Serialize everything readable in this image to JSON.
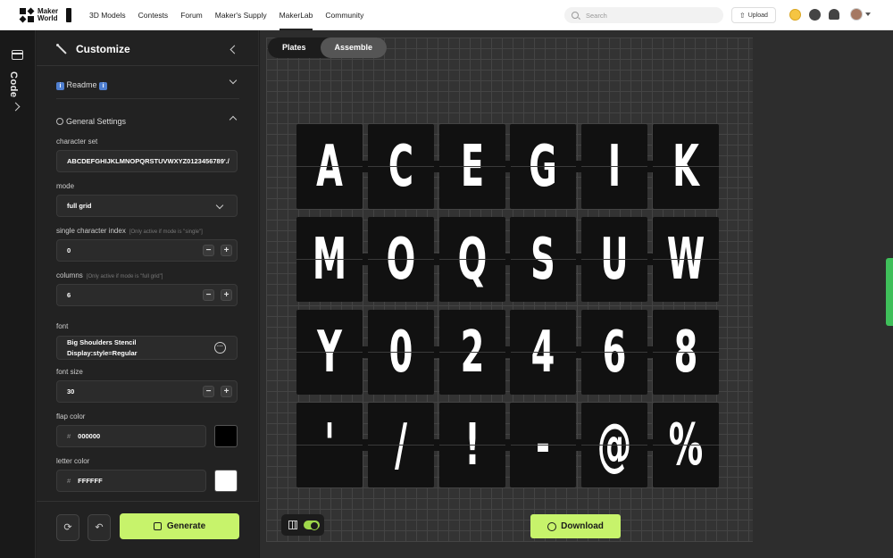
{
  "brand": {
    "name": "Maker World"
  },
  "nav": {
    "links": [
      "3D Models",
      "Contests",
      "Forum",
      "Maker's Supply",
      "MakerLab",
      "Community"
    ],
    "active": "MakerLab",
    "search_placeholder": "Search",
    "upload_label": "Upload"
  },
  "rail": {
    "label": "Code"
  },
  "panel": {
    "title": "Customize",
    "readme_label": "Readme",
    "general_label": "General Settings",
    "fields": {
      "character_set": {
        "label": "character set",
        "value": "ABCDEFGHIJKLMNOPQRSTUVWXYZ0123456789'./"
      },
      "mode": {
        "label": "mode",
        "value": "full grid"
      },
      "single_index": {
        "label": "single character index",
        "hint": "[Only active if mode is \"single\"]",
        "value": "0"
      },
      "columns": {
        "label": "columns",
        "hint": "[Only active if mode is \"full grid\"]",
        "value": "6"
      },
      "font": {
        "label": "font",
        "value_line1": "Big Shoulders Stencil",
        "value_line2": "Display:style=Regular"
      },
      "font_size": {
        "label": "font size",
        "value": "30"
      },
      "flap_color": {
        "label": "flap color",
        "value": "000000",
        "swatch": "#000000"
      },
      "letter_color": {
        "label": "letter color",
        "value": "FFFFFF",
        "swatch": "#FFFFFF"
      }
    },
    "generate_label": "Generate"
  },
  "canvas": {
    "tabs": [
      "Plates",
      "Assemble"
    ],
    "active_tab": "Assemble",
    "flaps": [
      "A",
      "C",
      "E",
      "G",
      "I",
      "K",
      "M",
      "O",
      "Q",
      "S",
      "U",
      "W",
      "Y",
      "0",
      "2",
      "4",
      "6",
      "8",
      "'",
      "/",
      "!",
      "-",
      "@",
      "%"
    ],
    "download_label": "Download"
  },
  "colors": {
    "accent": "#c7f36b",
    "panel_bg": "#222222"
  }
}
